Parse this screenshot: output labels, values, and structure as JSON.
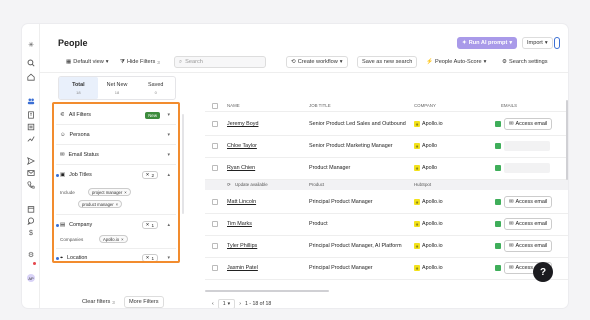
{
  "page": {
    "title": "People"
  },
  "header": {
    "default_view": "Default view",
    "hide_filters": "Hide Filters",
    "hide_filters_count": "3",
    "search_placeholder": "Search",
    "create_workflow": "Create workflow",
    "save_search": "Save as new search",
    "auto_score": "People Auto-Score",
    "search_settings": "Search settings",
    "run_ai_prompt": "Run AI prompt",
    "import": "Import"
  },
  "tabs": [
    {
      "label": "Total",
      "count": "18",
      "active": true
    },
    {
      "label": "Net New",
      "count": "18",
      "active": false
    },
    {
      "label": "Saved",
      "count": "0",
      "active": false
    }
  ],
  "filters": {
    "all_filters": "All Filters",
    "new_badge": "New",
    "persona": "Persona",
    "email_status": "Email Status",
    "job_titles": "Job Titles",
    "job_titles_count": "2",
    "include_label": "Include",
    "job_title_chips": [
      "project manager",
      "product manager"
    ],
    "company": "Company",
    "company_count": "1",
    "companies_label": "Companies",
    "company_chips": [
      "Apollo.io"
    ],
    "location": "Location",
    "location_count": "1",
    "clear_filters": "Clear filters",
    "clear_filters_count": "3",
    "more_filters": "More Filters"
  },
  "table": {
    "columns": [
      "NAME",
      "JOB TITLE",
      "COMPANY",
      "EMAILS"
    ],
    "subrow": {
      "update": "Update available",
      "product": "Product",
      "hubspot": "HubSpot"
    },
    "access_email": "Access email",
    "rows": [
      {
        "name": "Jeremy Boyd",
        "job": "Senior Product Led Sales and Outbound",
        "company": "Apollo.io",
        "email": "button"
      },
      {
        "name": "Chloe Taylor",
        "job": "Senior Product Marketing Manager",
        "company": "Apollo",
        "email": "pending"
      },
      {
        "name": "Ryan Chien",
        "job": "Product Manager",
        "company": "Apollo",
        "email": "pending"
      },
      {
        "name": "Matt Lincoln",
        "job": "Principal Product Manager",
        "company": "Apollo.io",
        "email": "button"
      },
      {
        "name": "Tim Marks",
        "job": "Product",
        "company": "Apollo.io",
        "email": "button"
      },
      {
        "name": "Tyler Phillips",
        "job": "Principal Product Manager, AI Platform",
        "company": "Apollo.io",
        "email": "button"
      },
      {
        "name": "Jasmin Patel",
        "job": "Principal Product Manager",
        "company": "Apollo.io",
        "email": "button"
      }
    ]
  },
  "pagination": {
    "page": "1",
    "range": "1 - 18 of 18"
  },
  "help": "?",
  "avatar": "AP"
}
